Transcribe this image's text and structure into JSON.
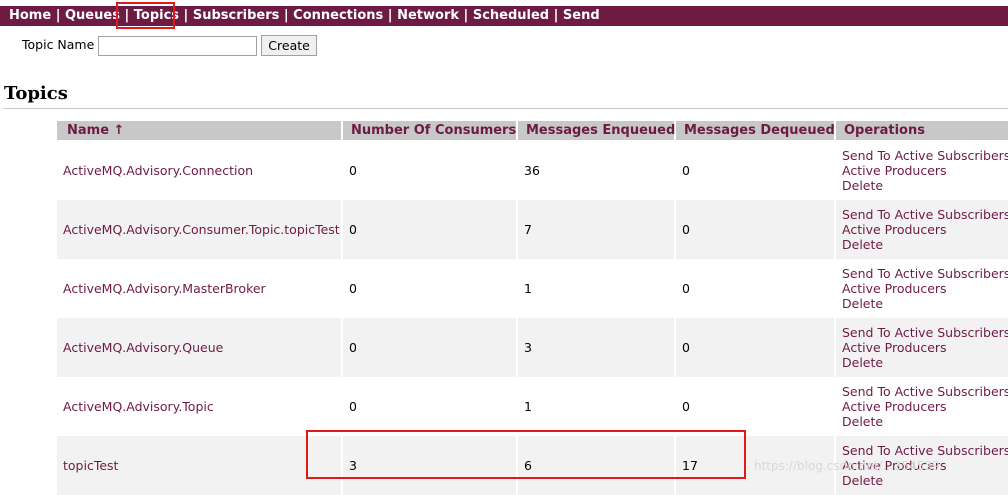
{
  "nav": {
    "items": [
      "Home",
      "Queues",
      "Topics",
      "Subscribers",
      "Connections",
      "Network",
      "Scheduled",
      "Send"
    ],
    "separator": " | "
  },
  "create": {
    "label": "Topic Name",
    "input_value": "",
    "button_label": "Create"
  },
  "heading": "Topics",
  "table": {
    "headers": [
      "Name ↑",
      "Number Of Consumers",
      "Messages Enqueued",
      "Messages Dequeued",
      "Operations"
    ],
    "rows": [
      {
        "name": "ActiveMQ.Advisory.Connection",
        "consumers": "0",
        "enqueued": "36",
        "dequeued": "0"
      },
      {
        "name": "ActiveMQ.Advisory.Consumer.Topic.topicTest",
        "consumers": "0",
        "enqueued": "7",
        "dequeued": "0"
      },
      {
        "name": "ActiveMQ.Advisory.MasterBroker",
        "consumers": "0",
        "enqueued": "1",
        "dequeued": "0"
      },
      {
        "name": "ActiveMQ.Advisory.Queue",
        "consumers": "0",
        "enqueued": "3",
        "dequeued": "0"
      },
      {
        "name": "ActiveMQ.Advisory.Topic",
        "consumers": "0",
        "enqueued": "1",
        "dequeued": "0"
      },
      {
        "name": "topicTest",
        "consumers": "3",
        "enqueued": "6",
        "dequeued": "17"
      }
    ],
    "operations": [
      "Send To Active Subscribers",
      "Active Producers",
      "Delete"
    ]
  },
  "watermark": "https://blog.csdn.net/...354529",
  "colors": {
    "nav_bg": "#6e1b44",
    "link": "#6e1b44",
    "header_bg": "#c8c8c8",
    "highlight_box": "#e01919"
  }
}
